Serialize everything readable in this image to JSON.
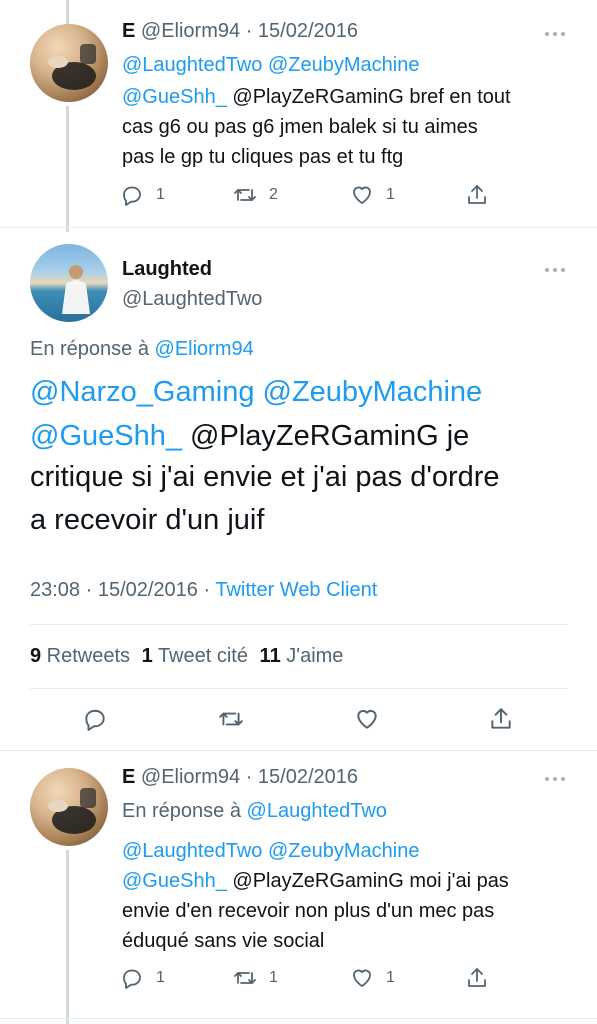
{
  "tweet1": {
    "name": "E",
    "handle": "@Eliorm94",
    "date": "· 15/02/2016",
    "mentions_line1": "@LaughtedTwo @ZeubyMachine",
    "mention_gueshh": "@GueShh_",
    "text_line1_rest": " @PlayZeRGaminG bref en tout",
    "text_line2": "cas g6 ou pas g6 jmen balek si tu aimes",
    "text_line3": "pas le gp tu cliques pas et tu ftg",
    "replies": "1",
    "retweets": "2",
    "likes": "1"
  },
  "tweet2": {
    "name": "Laughted",
    "handle": "@LaughtedTwo",
    "reply_prefix": "En réponse à ",
    "reply_to": "@Eliorm94",
    "mentions_line1": "@Narzo_Gaming @ZeubyMachine",
    "mention_gueshh": "@GueShh_",
    "text_line1_rest": " @PlayZeRGaminG je",
    "text_line2": "critique si j'ai envie et j'ai pas d'ordre",
    "text_line3": "a recevoir d'un juif",
    "time_date": "23:08 · 15/02/2016 · ",
    "client": "Twitter Web Client",
    "retweets_count": "9",
    "retweets_label": " Retweets",
    "quotes_count": "1",
    "quotes_label": " Tweet cité",
    "likes_count": "11",
    "likes_label": " J'aime"
  },
  "tweet3": {
    "name": "E",
    "handle": "@Eliorm94",
    "date": "· 15/02/2016",
    "reply_prefix": "En réponse à ",
    "reply_to": "@LaughtedTwo",
    "mentions_line1": "@LaughtedTwo @ZeubyMachine",
    "mention_gueshh": "@GueShh_",
    "text_line1_rest": " @PlayZeRGaminG moi j'ai pas",
    "text_line2": "envie d'en recevoir non plus d'un mec pas",
    "text_line3": "éduqué sans vie social",
    "replies": "1",
    "retweets": "1",
    "likes": "1"
  },
  "icons": {
    "reply": "reply-icon",
    "retweet": "retweet-icon",
    "like": "heart-icon",
    "share": "share-icon",
    "more": "more-icon"
  },
  "colors": {
    "link": "#1d9bf0",
    "muted": "#536471",
    "text": "#0f1419"
  }
}
